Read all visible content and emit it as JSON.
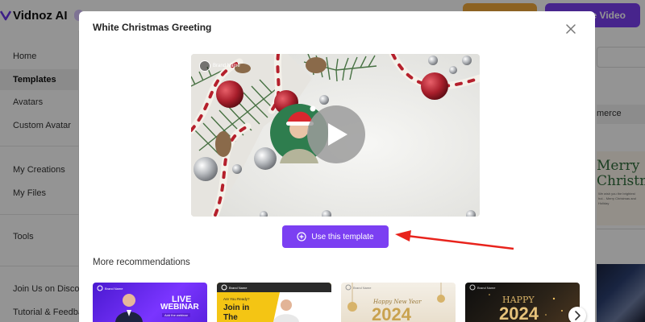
{
  "app": {
    "logo_text": "Vidnoz AI",
    "create_button_label": "te Video"
  },
  "sidebar": {
    "items": [
      {
        "label": "Home"
      },
      {
        "label": "Templates"
      },
      {
        "label": "Avatars"
      },
      {
        "label": "Custom Avatar"
      },
      {
        "label": "My Creations"
      },
      {
        "label": "My Files"
      },
      {
        "label": "Tools"
      },
      {
        "label": "Join Us on Discord"
      },
      {
        "label": "Tutorial & Feedback"
      }
    ],
    "active_item": "Templates"
  },
  "background_right": {
    "category_tag": "merce",
    "card_title_line1": "Merry",
    "card_title_line2": "Christm",
    "card_small_text": "We wish you the brightest hol... Merry Christmas and Holiday"
  },
  "modal": {
    "title": "White Christmas Greeting",
    "preview": {
      "brand_label": "Brand Name"
    },
    "use_button_label": "Use this template",
    "recommendations_title": "More recommendations",
    "recommendations": [
      {
        "brand": "Brand Name",
        "line1": "LIVE",
        "line2": "WEBINAR",
        "line3": "Add the webinar"
      },
      {
        "brand": "Brand Name",
        "line1": "Are You Ready?",
        "line2": "Join in",
        "line3": "The"
      },
      {
        "brand": "Brand Name",
        "line1": "Happy New Year",
        "line2": "2024"
      },
      {
        "brand": "Brand Name",
        "line1": "HAPPY",
        "line2": "2024"
      }
    ]
  },
  "colors": {
    "accent": "#7b3ff2",
    "orange": "#f2a93b",
    "annotation_arrow": "#e8231c"
  },
  "icons": {
    "close": "close-icon",
    "plus": "plus-circle-icon",
    "play": "play-icon",
    "next": "chevron-right-icon"
  }
}
